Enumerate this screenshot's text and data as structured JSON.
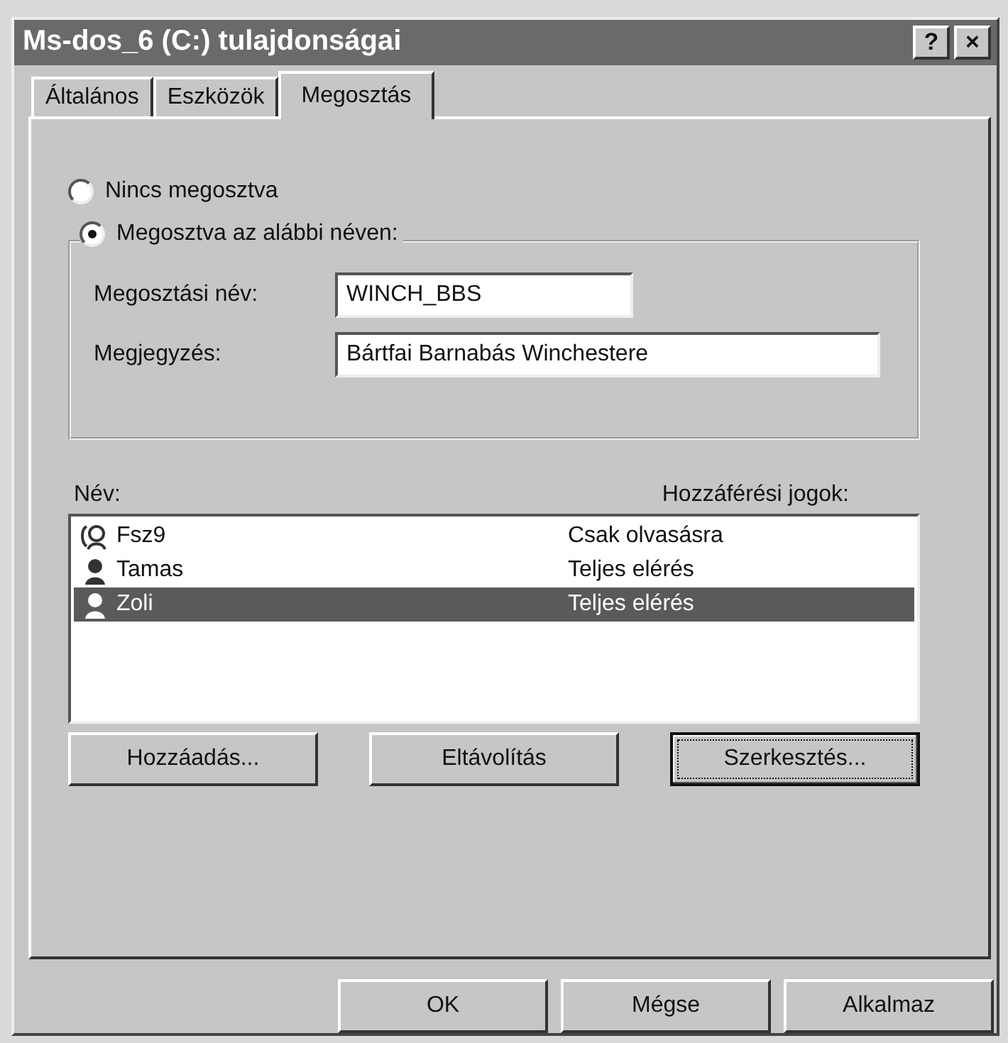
{
  "window": {
    "title": "Ms-dos_6 (C:) tulajdonságai",
    "title_buttons": [
      "?",
      "×"
    ]
  },
  "tabs": [
    {
      "label": "Általános",
      "selected": false
    },
    {
      "label": "Eszközök",
      "selected": false
    },
    {
      "label": "Megosztás",
      "selected": true
    }
  ],
  "share_options": [
    {
      "label": "Nincs megosztva",
      "selected": false
    },
    {
      "label": "Megosztva az alábbi néven:",
      "selected": true
    }
  ],
  "fields": [
    {
      "label": "Megosztási név:",
      "value": "WINCH_BBS"
    },
    {
      "label": "Megjegyzés:",
      "value": "Bártfai Barnabás Winchestere"
    }
  ],
  "list": {
    "columns": [
      "Név:",
      "Hozzáférési jogok:"
    ],
    "rows": [
      {
        "kind": "group",
        "name": "Fsz9",
        "rights": "Csak olvasásra",
        "selected": false
      },
      {
        "kind": "user",
        "name": "Tamas",
        "rights": "Teljes elérés",
        "selected": false
      },
      {
        "kind": "user",
        "name": "Zoli",
        "rights": "Teljes elérés",
        "selected": true
      }
    ]
  },
  "list_buttons": [
    {
      "label": "Hozzáadás...",
      "focused": false
    },
    {
      "label": "Eltávolítás",
      "focused": false
    },
    {
      "label": "Szerkesztés...",
      "focused": true
    }
  ],
  "dialog_buttons": [
    "OK",
    "Mégse",
    "Alkalmaz"
  ]
}
